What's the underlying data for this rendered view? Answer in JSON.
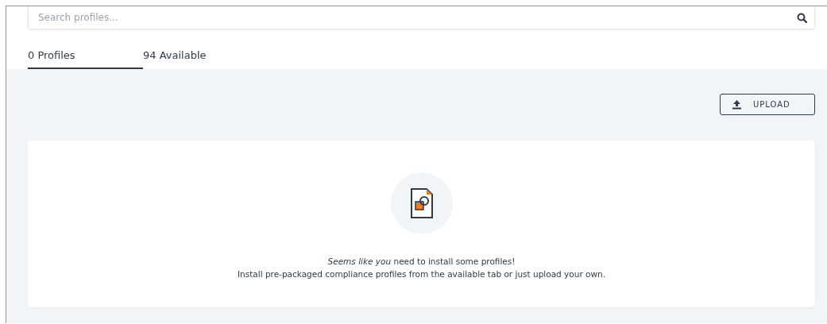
{
  "search": {
    "placeholder": "Search profiles..."
  },
  "tabs": [
    {
      "label": "0 Profiles",
      "selected": true
    },
    {
      "label": "94 Available",
      "selected": false
    }
  ],
  "upload_button": {
    "label": "UPLOAD"
  },
  "empty_state": {
    "message": "*Seems like you* need to install some profiles!",
    "hint": "Install pre-packaged compliance profiles from the available tab or just upload your own."
  }
}
